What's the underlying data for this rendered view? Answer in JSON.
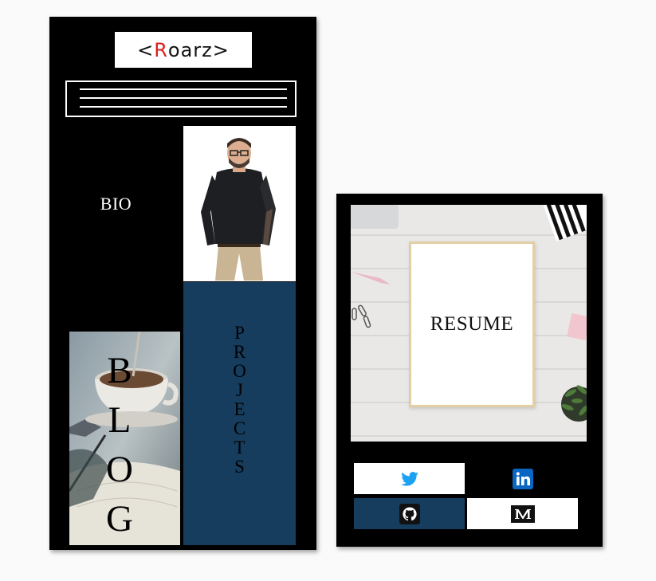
{
  "logo": {
    "prefix": "<",
    "accent": "R",
    "rest": "oarz>"
  },
  "menu": {
    "icon": "hamburger-menu-icon"
  },
  "tiles": {
    "bio": "BIO",
    "projects": [
      "P",
      "R",
      "O",
      "J",
      "E",
      "C",
      "T",
      "S"
    ],
    "blog": [
      "B",
      "L",
      "O",
      "G"
    ],
    "resume": "RESUME"
  },
  "social": [
    {
      "name": "twitter",
      "icon": "twitter-icon",
      "color": "#1da1f2"
    },
    {
      "name": "linkedin",
      "icon": "linkedin-icon",
      "color": "#0a66c2"
    },
    {
      "name": "github",
      "icon": "github-icon",
      "color": "#000000"
    },
    {
      "name": "medium",
      "icon": "medium-icon",
      "color": "#000000"
    }
  ],
  "colors": {
    "navy": "#163d5e",
    "logo_accent": "#e01e1e",
    "card": "#000000"
  }
}
